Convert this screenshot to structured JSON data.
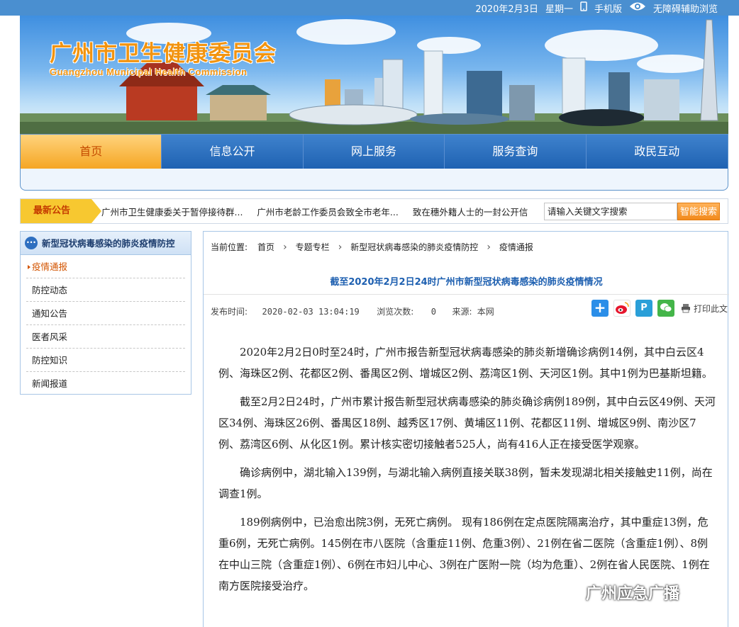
{
  "topbar": {
    "date": "2020年2月3日",
    "weekday": "星期一",
    "mobile_label": "手机版",
    "accessibility_label": "无障碍辅助浏览"
  },
  "site": {
    "name_cn": "广州市卫生健康委员会",
    "name_en": "Guangzhou Municipal Health Commission"
  },
  "nav": {
    "items": [
      {
        "label": "首页"
      },
      {
        "label": "信息公开"
      },
      {
        "label": "网上服务"
      },
      {
        "label": "服务查询"
      },
      {
        "label": "政民互动"
      }
    ]
  },
  "notice": {
    "tag": "最新公告",
    "items": [
      "广州市卫生健康委关于暂停接待群...",
      "广州市老龄工作委员会致全市老年...",
      "致在穗外籍人士的一封公开信"
    ],
    "search_placeholder": "请输入关键文字搜索",
    "search_button": "智能搜索"
  },
  "sidebar": {
    "title": "新型冠状病毒感染的肺炎疫情防控",
    "items": [
      {
        "label": "疫情通报"
      },
      {
        "label": "防控动态"
      },
      {
        "label": "通知公告"
      },
      {
        "label": "医者风采"
      },
      {
        "label": "防控知识"
      },
      {
        "label": "新闻报道"
      }
    ]
  },
  "breadcrumb": {
    "prefix": "当前位置:",
    "items": [
      "首页",
      "专题专栏",
      "新型冠状病毒感染的肺炎疫情防控",
      "疫情通报"
    ]
  },
  "article": {
    "title": "截至2020年2月2日24时广州市新型冠状病毒感染的肺炎疫情情况",
    "publish_label": "发布时间:",
    "publish_time": "2020-02-03 13:04:19",
    "views_label": "浏览次数:",
    "views": "0",
    "source_label": "来源:",
    "source": "本网",
    "print_label": "打印此文",
    "paragraphs": [
      "2020年2月2日0时至24时，广州市报告新型冠状病毒感染的肺炎新增确诊病例14例，其中白云区4例、海珠区2例、花都区2例、番禺区2例、增城区2例、荔湾区1例、天河区1例。其中1例为巴基斯坦籍。",
      "截至2月2日24时，广州市累计报告新型冠状病毒感染的肺炎确诊病例189例，其中白云区49例、天河区34例、海珠区26例、番禺区18例、越秀区17例、黄埔区11例、花都区11例、增城区9例、南沙区7例、荔湾区6例、从化区1例。累计核实密切接触者525人，尚有416人正在接受医学观察。",
      "确诊病例中，湖北输入139例，与湖北输入病例直接关联38例，暂未发现湖北相关接触史11例，尚在调查1例。",
      "189例病例中，已治愈出院3例，无死亡病例。 现有186例在定点医院隔离治疗，其中重症13例，危重6例，无死亡病例。145例在市八医院（含重症11例、危重3例）、21例在省二医院（含重症1例）、8例在中山三院（含重症1例）、6例在市妇儿中心、3例在广医附一院（均为危重）、2例在省人民医院、1例在南方医院接受治疗。"
    ]
  },
  "watermark": "广州应急广播"
}
